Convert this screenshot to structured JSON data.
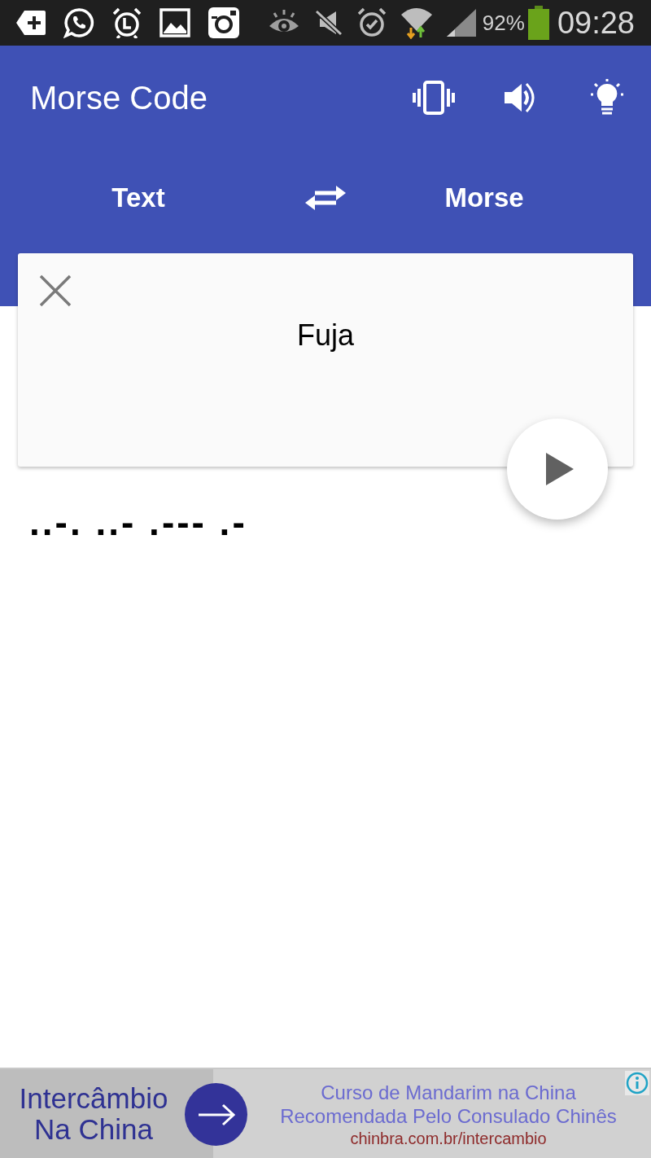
{
  "status_bar": {
    "battery": "92%",
    "time": "09:28"
  },
  "app_bar": {
    "title": "Morse Code"
  },
  "direction": {
    "source": "Text",
    "target": "Morse"
  },
  "input": {
    "value": "Fuja"
  },
  "output": {
    "morse": "..-. ..- .--- .-"
  },
  "ad": {
    "headline": "Intercâmbio Na China",
    "lines": [
      "Curso de Mandarim na China",
      "Recomendada Pelo Consulado Chinês"
    ],
    "url": "chinbra.com.br/intercambio"
  }
}
